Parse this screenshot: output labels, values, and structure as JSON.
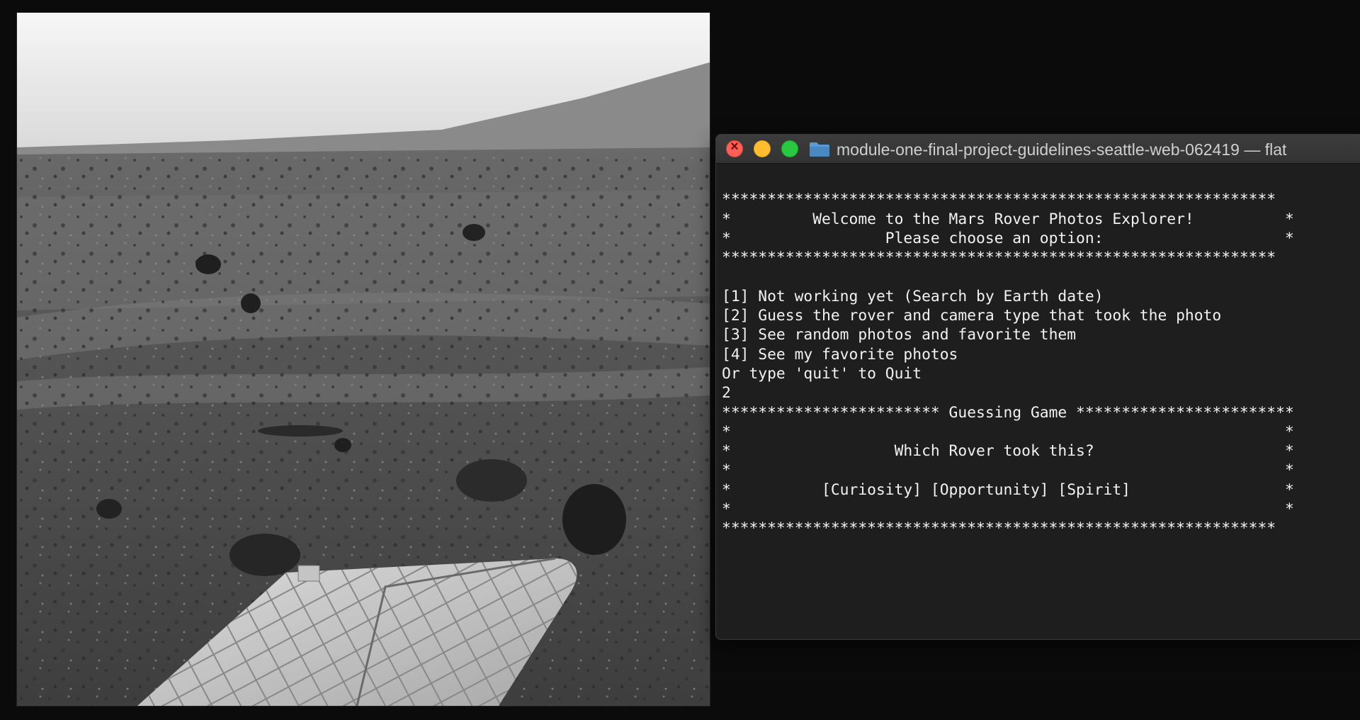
{
  "terminal": {
    "title": "module-one-final-project-guidelines-seattle-web-062419 — flat",
    "lines": [
      "",
      "*************************************************************",
      "*         Welcome to the Mars Rover Photos Explorer!          *",
      "*                 Please choose an option:                    *",
      "*************************************************************",
      "",
      "[1] Not working yet (Search by Earth date)",
      "[2] Guess the rover and camera type that took the photo",
      "[3] See random photos and favorite them",
      "[4] See my favorite photos",
      "Or type 'quit' to Quit",
      "2",
      "************************ Guessing Game ************************",
      "*                                                             *",
      "*                  Which Rover took this?                     *",
      "*                                                             *",
      "*          [Curiosity] [Opportunity] [Spirit]                 *",
      "*                                                             *",
      "*************************************************************"
    ]
  },
  "icons": {
    "close": "close-icon",
    "minimize": "minimize-icon",
    "maximize": "maximize-icon",
    "folder": "folder-icon"
  },
  "colors": {
    "close": "#fe5f57",
    "minimize": "#febc2e",
    "maximize": "#28c840",
    "terminal_bg": "#1e1e1e",
    "terminal_text": "#f2f2f2"
  }
}
